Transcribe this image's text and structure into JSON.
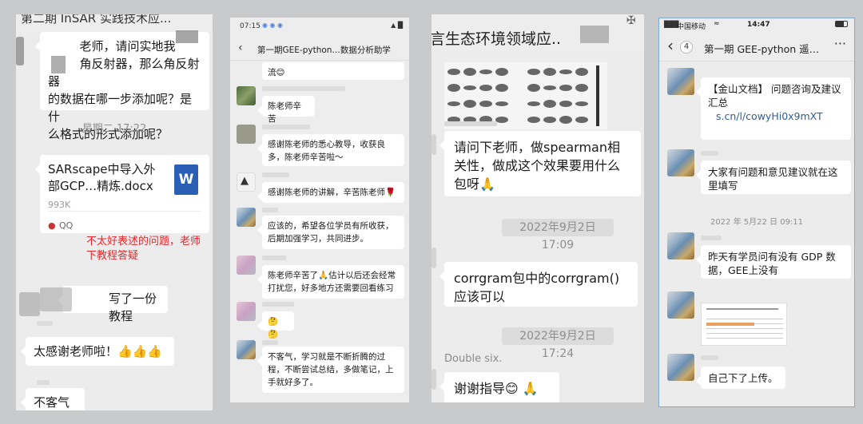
{
  "panel1": {
    "title": "第二期 InSAR 实践技术应...",
    "msg1": "　 　 老师，请问实地我\n　 　 角反射器，那么角反射器\n的数据在哪一步添加呢？是什\n么格式的形式添加呢？",
    "timestamp": "星期二 17:22",
    "file_name": "SARscape中导入外部GCP…精炼.docx",
    "file_size": "993K",
    "file_icon_letter": "W",
    "file_source": "QQ",
    "annotation": "不太好表述的问题，老师\n下教程答疑",
    "msg3": "写了一份教程",
    "msg4": "太感谢老师啦！👍👍👍",
    "msg5": "不客气"
  },
  "panel2": {
    "time": "07:15",
    "title": "第一期GEE-python…数据分析助学",
    "msg0": "流😊",
    "msg1": "陈老师辛苦",
    "msg2": "感谢陈老师的悉心教导，收获良多，陈老师辛苦啦～",
    "msg3": "感谢陈老师的讲解，辛苦陈老师🌹",
    "msg4": "应该的，希望各位学员有所收获，后期加强学习，共同进步。",
    "msg5": "陈老师辛苦了🙏估计以后还会经常打扰您，好多地方还需要回看练习",
    "msg6": "🤔🤔",
    "msg7": "不客气，学习就是不断折腾的过程，不断尝试总结，多做笔记，上手就好多了。"
  },
  "panel3": {
    "title": "言生态环境领域应..",
    "msg1": "请问下老师，做spearman相关性，做成这个效果要用什么包呀🙏",
    "ts1": "2022年9月2日 17:09",
    "msg2": "corrgram包中的corrgram()应该可以",
    "ts2": "2022年9月2日 17:24",
    "sender": "Double six.",
    "msg3": "谢谢指导😊 🙏"
  },
  "panel4": {
    "carrier": "中国移动",
    "time": "14:47",
    "badge": "4",
    "title": "第一期 GEE-python 遥…",
    "link_title": "【金山文档】 问题咨询及建议汇总",
    "link_url": "s.cn/l/cowyHi0x9mXT",
    "msg2": "大家有问题和意见建议就在这里填写",
    "ts": "2022 年 5月22 日 09:11",
    "msg3": "昨天有学员问有没有 GDP 数据，GEE上没有",
    "msg4": "自己下了上传。"
  },
  "colors": {
    "annotation_red": "#e8262a",
    "word_blue": "#2b5fb5",
    "link_blue": "#2f5d9a",
    "chat_bg": "#ececec",
    "bubble_white": "#ffffff"
  }
}
